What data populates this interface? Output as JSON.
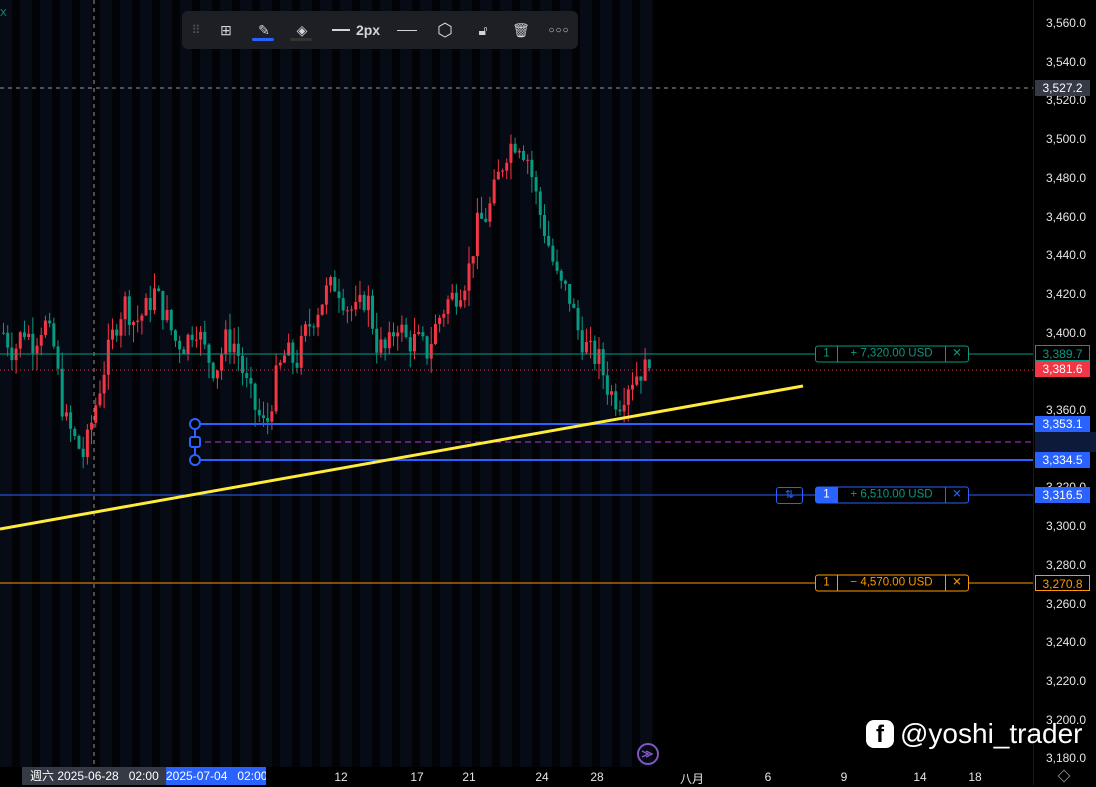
{
  "toolbar": {
    "width_label": "2px",
    "items": [
      "drag-handle",
      "templates",
      "pencil",
      "fill-color",
      "line-width",
      "line-style",
      "settings",
      "lock",
      "delete",
      "more"
    ]
  },
  "corner_label": "X",
  "price_axis": {
    "ticks": [
      "3,560.0",
      "3,540.0",
      "3,520.0",
      "3,500.0",
      "3,480.0",
      "3,460.0",
      "3,440.0",
      "3,420.0",
      "3,400.0",
      "3,380.0",
      "3,360.0",
      "3,340.0",
      "3,320.0",
      "3,300.0",
      "3,280.0",
      "3,260.0",
      "3,240.0",
      "3,220.0",
      "3,200.0",
      "3,180.0"
    ],
    "crosshair_price": "3,527.2",
    "tp_price": "3,389.7",
    "last_price": "3,381.6",
    "upper_level": "3,353.1",
    "lower_level": "3,334.5",
    "entry_price": "3,316.5",
    "sl_price": "3,270.8"
  },
  "time_axis": {
    "ticks": [
      {
        "label": "12",
        "v": 12
      },
      {
        "label": "17",
        "v": 17
      },
      {
        "label": "21",
        "v": 21
      },
      {
        "label": "24",
        "v": 24
      },
      {
        "label": "28",
        "v": 28
      },
      {
        "label": "八月",
        "v": 32
      },
      {
        "label": "6",
        "v": 6
      },
      {
        "label": "9",
        "v": 9
      },
      {
        "label": "14",
        "v": 14
      },
      {
        "label": "18",
        "v": 18
      }
    ],
    "crosshair_date": "週六 2025-06-28   02:00",
    "selected_date": "2025-07-04   02:00"
  },
  "positions": {
    "tp": {
      "qty": "1",
      "pnl": "+ 7,320.00 USD",
      "close": "✕"
    },
    "entry": {
      "qty": "1",
      "pnl": "+ 6,510.00 USD",
      "close": "✕",
      "reverse": "⇅"
    },
    "sl": {
      "qty": "1",
      "pnl": "− 4,570.00 USD",
      "close": "✕"
    }
  },
  "watermark": "@yoshi_trader",
  "colors": {
    "up": "#f23645",
    "down": "#089981",
    "tp": "#089981",
    "entry": "#2962ff",
    "sl": "#ff9800",
    "trend": "#ffeb3b",
    "mid": "#b03dd6"
  },
  "candles_close": [
    3400,
    3390,
    3402,
    3395,
    3406,
    3392,
    3356,
    3345,
    3336,
    3360,
    3382,
    3402,
    3416,
    3405,
    3411,
    3421,
    3410,
    3396,
    3394,
    3405,
    3390,
    3380,
    3396,
    3394,
    3374,
    3360,
    3350,
    3376,
    3390,
    3384,
    3401,
    3411,
    3421,
    3426,
    3414,
    3410,
    3420,
    3394,
    3390,
    3406,
    3395,
    3396,
    3390,
    3406,
    3416,
    3421,
    3430,
    3456,
    3461,
    3480,
    3496,
    3500,
    3490,
    3465,
    3446,
    3425,
    3420,
    3400,
    3390,
    3386,
    3370,
    3364,
    3375,
    3380,
    3381.6
  ]
}
